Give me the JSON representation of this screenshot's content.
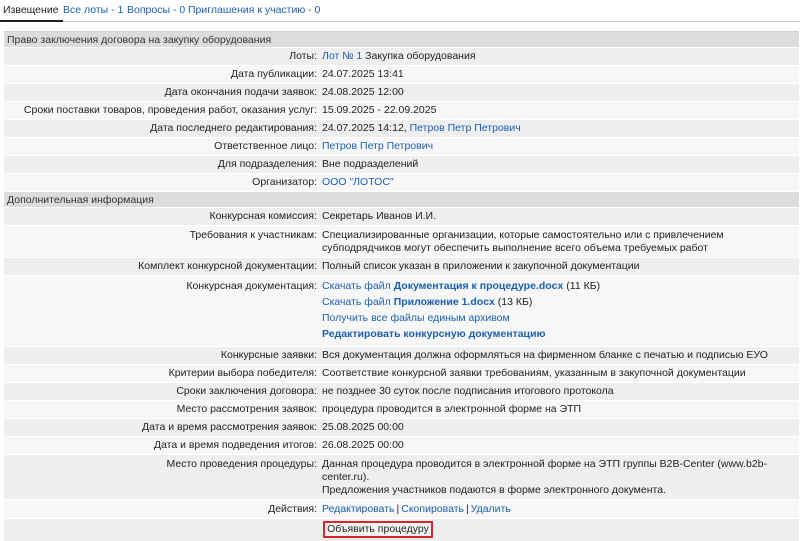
{
  "tabs": [
    {
      "label": "Извещение"
    },
    {
      "label": "Все лоты - 1"
    },
    {
      "label": "Вопросы - 0"
    },
    {
      "label": "Приглашения к участию - 0"
    }
  ],
  "section1": {
    "title": "Право заключения договора на закупку оборудования",
    "lots_label": "Лоты:",
    "lot_link": "Лот № 1",
    "lot_name": "Закупка оборудования",
    "pub_label": "Дата публикации:",
    "pub_value": "24.07.2025 13:41",
    "deadline_label": "Дата окончания подачи заявок:",
    "deadline_value": "24.08.2025 12:00",
    "delivery_label": "Сроки поставки товаров, проведения работ, оказания услуг:",
    "delivery_value": "15.09.2025 - 22.09.2025",
    "edited_label": "Дата последнего редактирования:",
    "edited_value": "24.07.2025 14:12,",
    "edited_user": "Петров Петр Петрович",
    "resp_label": "Ответственное лицо:",
    "resp_value": "Петров Петр Петрович",
    "dept_label": "Для подразделения:",
    "dept_value": "Вне подразделений",
    "org_label": "Организатор:",
    "org_value": "ООО \"ЛОТОС\""
  },
  "section2": {
    "title": "Дополнительная информация",
    "commission_label": "Конкурсная комиссия:",
    "commission_value": "Секретарь Иванов И.И.",
    "req_label": "Требования к участникам:",
    "req_value": "Специализированные организации, которые самостоятельно или с привлечением субподрядчиков могут обеспечить выполнение всего объема требуемых работ",
    "kit_label": "Комплект конкурсной документации:",
    "kit_value": "Полный список указан в приложении к закупочной документации",
    "docs_label": "Конкурсная документация:",
    "doc1_prefix": "Скачать файл",
    "doc1_name": "Документация к процедуре.docx",
    "doc1_size": "(11 КБ)",
    "doc2_prefix": "Скачать файл",
    "doc2_name": "Приложение 1.docx",
    "doc2_size": "(13 КБ)",
    "archive_link": "Получить все файлы единым архивом",
    "edit_docs_link": "Редактировать конкурсную документацию",
    "bids_label": "Конкурсные заявки:",
    "bids_value": "Вся документация должна оформляться на фирменном бланке с печатью и подписью ЕУО",
    "criteria_label": "Критерии выбора победителя:",
    "criteria_value": "Соответствие конкурсной заявки требованиям, указанным в закупочной документации",
    "contract_label": "Сроки заключения договора:",
    "contract_value": "не позднее 30 суток после подписания итогового протокола",
    "review_place_label": "Место рассмотрения заявок:",
    "review_place_value": "процедура проводится в электронной форме на ЭТП",
    "review_date_label": "Дата и время рассмотрения заявок:",
    "review_date_value": "25.08.2025 00:00",
    "results_label": "Дата и время подведения итогов:",
    "results_value": "26.08.2025 00:00",
    "venue_label": "Место проведения процедуры:",
    "venue_line1": "Данная процедура проводится в электронной форме на ЭТП группы B2B-Center (www.b2b-center.ru).",
    "venue_line2": "Предложения участников подаются в форме электронного документа.",
    "actions_label": "Действия:",
    "action_edit": "Редактировать",
    "action_copy": "Скопировать",
    "action_delete": "Удалить",
    "separator": "|",
    "announce_button": "Объявить процедуру"
  },
  "colors": {
    "link": "#1a5fb4",
    "section_bg": "#dcdcdc",
    "row_alt": "#eeeeee",
    "button_border": "#d9262c"
  }
}
